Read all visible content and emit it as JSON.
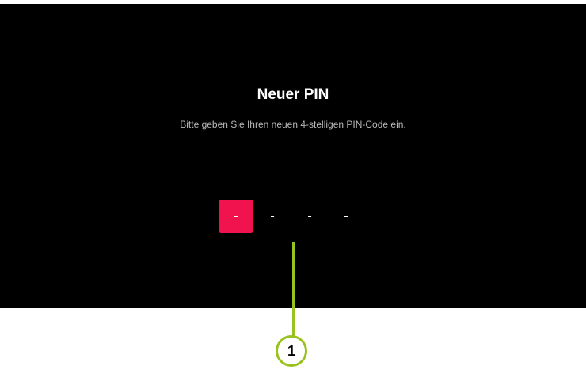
{
  "dialog": {
    "title": "Neuer PIN",
    "subtitle": "Bitte geben Sie Ihren neuen 4-stelligen PIN-Code ein."
  },
  "pin": {
    "digits": [
      "-",
      "-",
      "-",
      "-"
    ],
    "active_index": 0
  },
  "annotation": {
    "callout_number": "1"
  },
  "colors": {
    "background": "#000000",
    "accent": "#f0134d",
    "callout": "#9ac21f"
  }
}
